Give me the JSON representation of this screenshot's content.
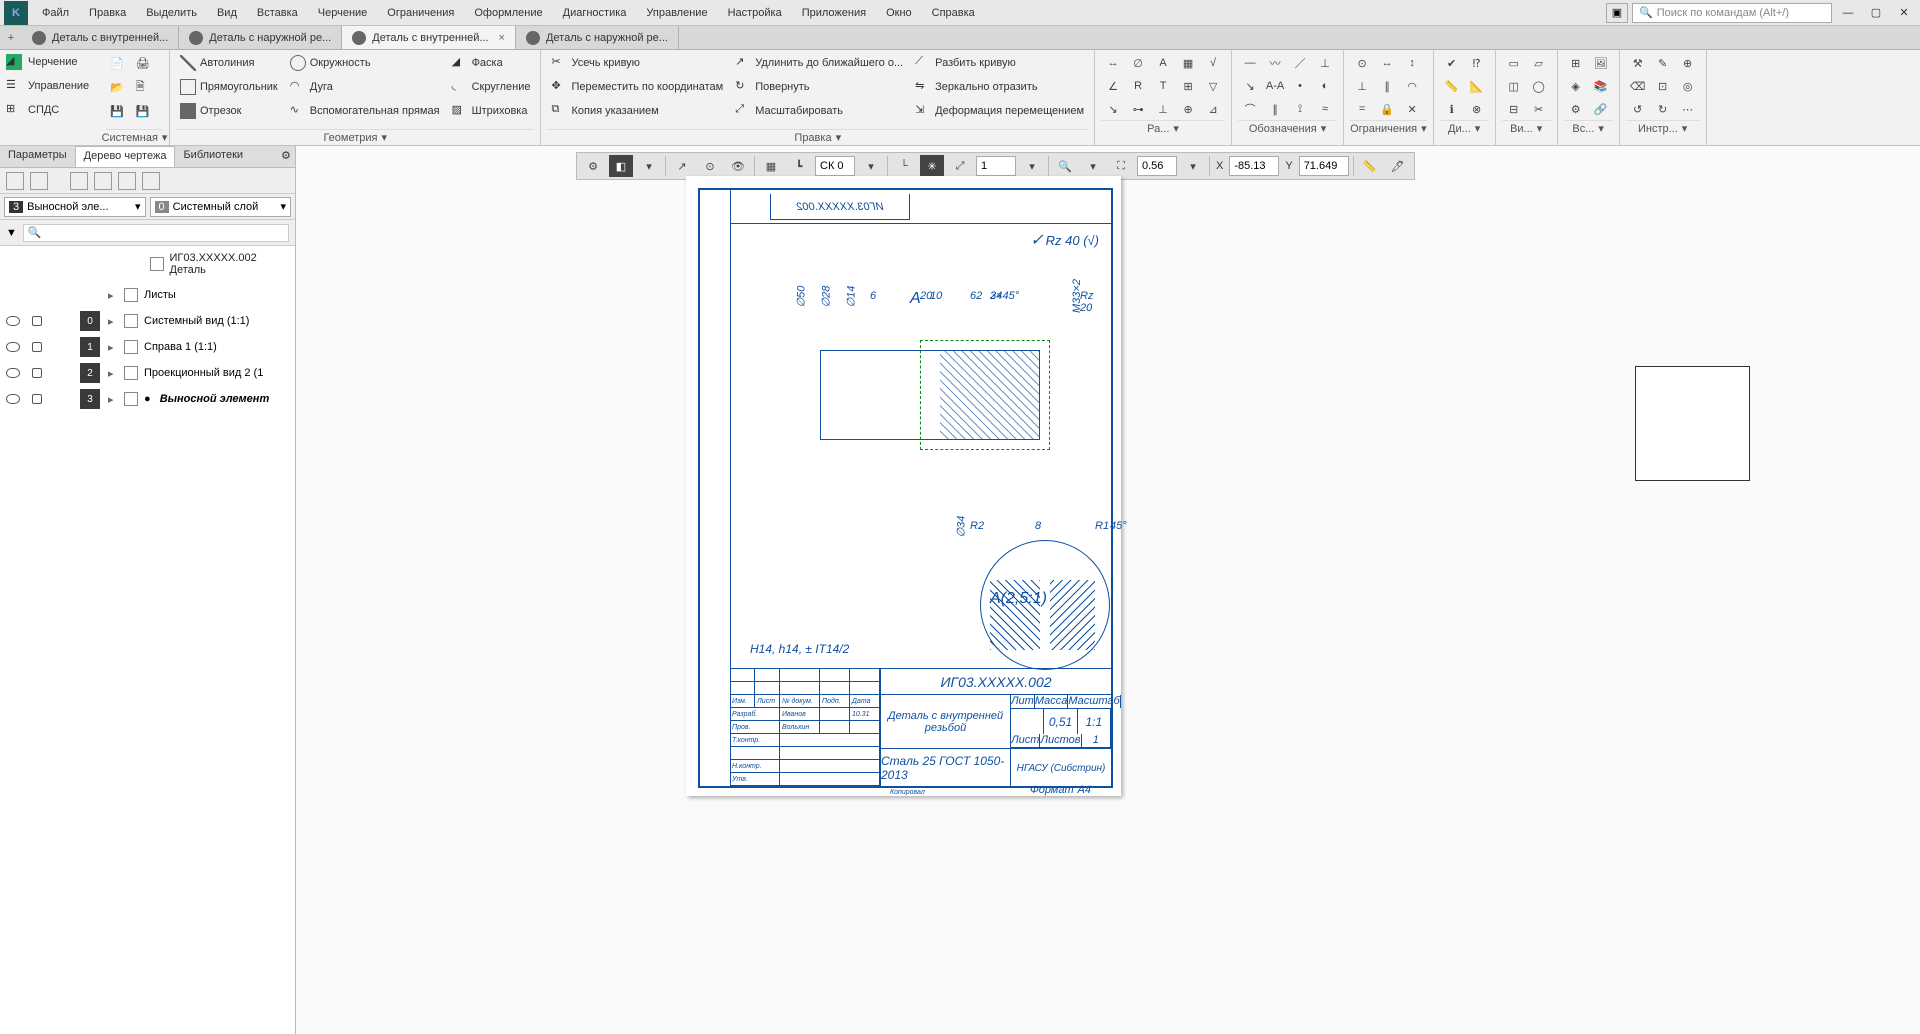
{
  "menu": {
    "file": "Файл",
    "edit": "Правка",
    "select": "Выделить",
    "view": "Вид",
    "insert": "Вставка",
    "drafting": "Черчение",
    "constraints": "Ограничения",
    "format": "Оформление",
    "diag": "Диагностика",
    "manage": "Управление",
    "setup": "Настройка",
    "apps": "Приложения",
    "window": "Окно",
    "help": "Справка"
  },
  "search_placeholder": "Поиск по командам (Alt+/)",
  "doc_tabs": [
    {
      "label": "Деталь с внутренней...",
      "active": false
    },
    {
      "label": "Деталь с наружной ре...",
      "active": false
    },
    {
      "label": "Деталь с внутренней...",
      "active": true,
      "closable": true
    },
    {
      "label": "Деталь с наружной ре...",
      "active": false
    }
  ],
  "ribbon_left": {
    "draft": "Черчение",
    "manage": "Управление",
    "spds": "СПДС"
  },
  "ribbon": {
    "system": "Системная",
    "geometry": {
      "label": "Геометрия",
      "autoline": "Автолиния",
      "circle": "Окружность",
      "chamfer": "Фаска",
      "rect": "Прямоугольник",
      "arc": "Дуга",
      "fillet": "Скругление",
      "seg": "Отрезок",
      "aux": "Вспомогательная прямая",
      "hatch": "Штриховка"
    },
    "edit": {
      "label": "Правка",
      "trim": "Усечь кривую",
      "extend": "Удлинить до ближайшего о...",
      "split": "Разбить кривую",
      "coords": "Переместить по координатам",
      "rotate": "Повернуть",
      "mirror": "Зеркально отразить",
      "copy": "Копия указанием",
      "scale": "Масштабировать",
      "deform": "Деформация перемещением"
    },
    "dims": "Ра...",
    "annos": "Обозначения",
    "constr": "Ограничения",
    "diag": "Ди...",
    "views": "Ви...",
    "insert": "Вс...",
    "tools": "Инстр..."
  },
  "panel_tabs": {
    "params": "Параметры",
    "tree": "Дерево чертежа",
    "libs": "Библиотеки"
  },
  "dd_view": {
    "num": "3",
    "label": "Выносной эле..."
  },
  "dd_layer": {
    "num": "0",
    "label": "Системный слой"
  },
  "tree": {
    "title": "ИГ03.XXXXX.002 Деталь",
    "rows": [
      {
        "num": "",
        "label": "Листы",
        "gutter": false
      },
      {
        "num": "0",
        "label": "Системный вид (1:1)",
        "gutter": true
      },
      {
        "num": "1",
        "label": "Справа 1 (1:1)",
        "gutter": true
      },
      {
        "num": "2",
        "label": "Проекционный вид 2 (1",
        "gutter": true
      },
      {
        "num": "3",
        "label": "Выносной элемент",
        "gutter": true,
        "active": true
      }
    ]
  },
  "viewbar": {
    "cs": "СК 0",
    "scale": "1",
    "zoom": "0.56",
    "x_label": "X",
    "x": "-85.13",
    "y_label": "Y",
    "y": "71.649"
  },
  "drawing": {
    "code_rev": "ИГ03.XXXXX.002",
    "rz": "Rz 40 (√)",
    "dims": {
      "d62": "62",
      "d20": "20",
      "d10": "10",
      "d50": "∅50",
      "d28": "∅28",
      "d14": "∅14",
      "d6": "6",
      "m33": "M33×2",
      "rz20": "Rz 20",
      "ch": "2×45°",
      "d34": "34",
      "aLabel": "А",
      "detTitle": "А(2,5:1)",
      "d8": "8",
      "d34b": "∅34",
      "d45": "45°",
      "r1": "R1",
      "r2": "R2"
    },
    "tol": "H14, h14, ± IT14/2",
    "tb": {
      "code": "ИГ03.XXXXX.002",
      "name": "Деталь с внутренней резьбой",
      "lit": "Лит",
      "massa": "Масса",
      "scale": "Масштаб",
      "massa_v": "0,51",
      "scale_v": "1:1",
      "mat": "Сталь 25  ГОСТ 1050-2013",
      "org": "НГАСУ (Сибстрин)",
      "rows": [
        {
          "c1": "Изм.",
          "c2": "Лист",
          "c3": "№ докум.",
          "c4": "Подп.",
          "c5": "Дата"
        },
        {
          "c1": "Разраб.",
          "c2": "Иванов",
          "c5": "10.31"
        },
        {
          "c1": "Пров.",
          "c2": "Вольхин"
        },
        {
          "c1": "Т.контр."
        },
        {
          "c1": ""
        },
        {
          "c1": "Н.контр."
        },
        {
          "c1": "Утв."
        }
      ],
      "sheet": "Лист",
      "sheets": "Листов",
      "sheets_v": "1",
      "format": "Формат",
      "format_v": "А4",
      "copy": "Копировал"
    }
  }
}
